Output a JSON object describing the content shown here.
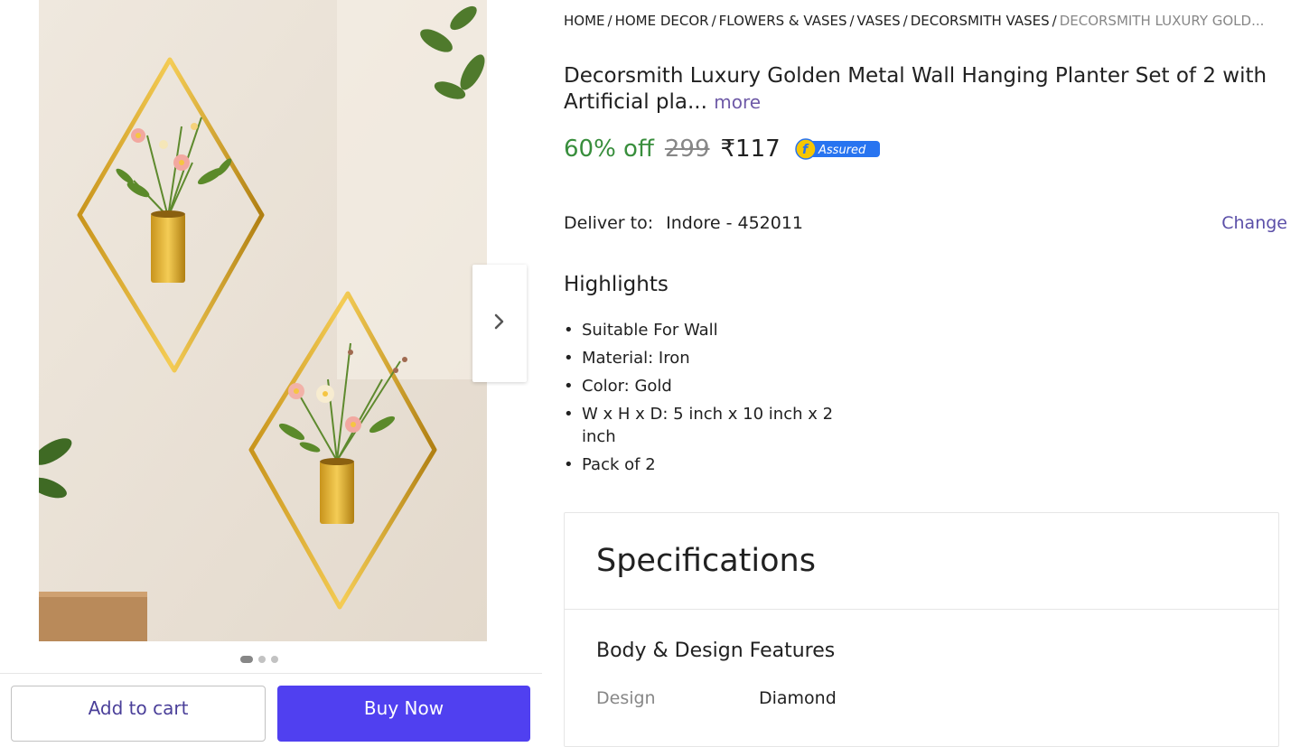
{
  "breadcrumb": [
    "HOME",
    "HOME DECOR",
    "FLOWERS & VASES",
    "VASES",
    "DECORSMITH VASES"
  ],
  "breadcrumb_current": "DECORSMITH LUXURY GOLD...",
  "product": {
    "title": "Decorsmith Luxury Golden Metal Wall Hanging Planter Set of 2 with Artificial pla...",
    "more_label": "more",
    "discount": "60% off",
    "mrp": "299",
    "price": "₹117",
    "assured_label": "Assured"
  },
  "delivery": {
    "label": "Deliver to:",
    "location": "Indore - 452011",
    "change_label": "Change"
  },
  "highlights": {
    "title": "Highlights",
    "items": [
      "Suitable For Wall",
      "Material: Iron",
      "Color: Gold",
      "W x H x D: 5 inch x 10 inch x 2 inch",
      "Pack of 2"
    ]
  },
  "specifications": {
    "title": "Specifications",
    "section": "Body & Design Features",
    "rows": [
      {
        "key": "Design",
        "value": "Diamond"
      }
    ]
  },
  "actions": {
    "add_to_cart": "Add to cart",
    "buy_now": "Buy Now"
  },
  "carousel": {
    "total": 3,
    "active": 0
  },
  "colors": {
    "discount": "#388e3c",
    "buy_now": "#5040f0",
    "link": "#5b4fa8",
    "assured": "#2874f0"
  }
}
